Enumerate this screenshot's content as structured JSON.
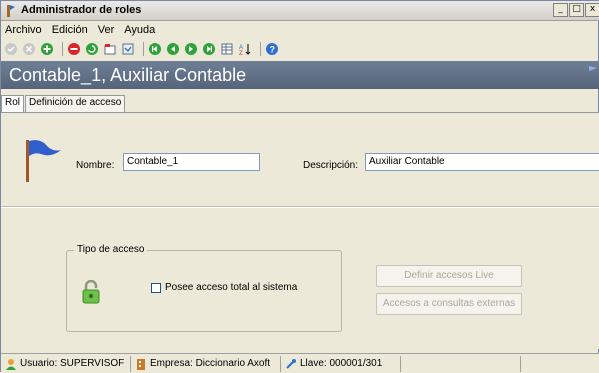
{
  "window": {
    "title": "Administrador de roles",
    "buttons": {
      "minimize": "_",
      "maximize": "□",
      "close": "x"
    }
  },
  "menu": [
    {
      "label": "Archivo"
    },
    {
      "label": "Edición"
    },
    {
      "label": "Ver"
    },
    {
      "label": "Ayuda"
    }
  ],
  "toolbar": {
    "icons": [
      "check-icon",
      "cancel-icon",
      "add-icon",
      "delete-icon",
      "refresh-icon",
      "edit-icon",
      "copy-icon",
      "first-icon",
      "prev-icon",
      "next-icon",
      "last-icon",
      "grid-icon",
      "sort-icon",
      "help-icon"
    ]
  },
  "banner": {
    "title": "Contable_1, Auxiliar Contable"
  },
  "tabs": [
    {
      "label": "Rol",
      "active": true
    },
    {
      "label": "Definición de acceso",
      "active": false
    }
  ],
  "form": {
    "nombre_label": "Nombre:",
    "nombre_value": "Contable_1",
    "descripcion_label": "Descripción:",
    "descripcion_value": "Auxiliar Contable"
  },
  "access": {
    "group_title": "Tipo de acceso",
    "checkbox_label": "Posee acceso total al sistema",
    "checked": false,
    "btn_definir": "Definir accesos Live",
    "btn_externas": "Accesos a consultas externas"
  },
  "status": {
    "usuario": "Usuario: SUPERVISOF",
    "empresa": "Empresa: Diccionario Axoft",
    "llave": "Llave: 000001/301"
  },
  "colors": {
    "banner": "#5f6f86",
    "window_bg": "#ece9d8"
  }
}
